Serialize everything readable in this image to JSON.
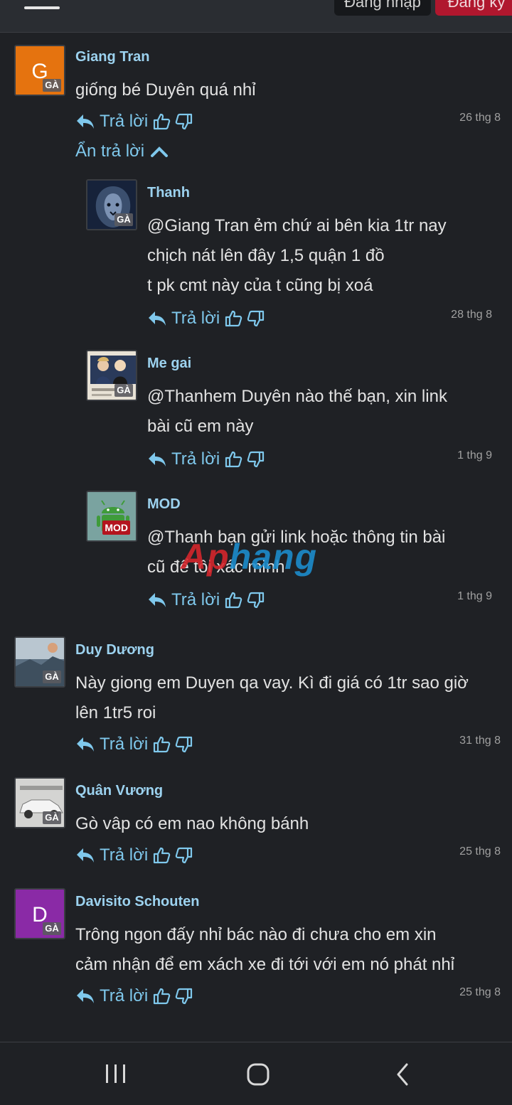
{
  "header": {
    "login_label": "Đăng nhập",
    "register_label": "Đăng ký"
  },
  "labels": {
    "reply": "Trả lời",
    "hide_replies": "Ẩn trả lời"
  },
  "comments": [
    {
      "author": "Giang Tran",
      "avatar_letter": "G",
      "avatar_color": "#e5730f",
      "badge": "GÀ",
      "lines": [
        "giống bé Duyên quá nhỉ"
      ],
      "time": "26 thg 8"
    },
    {
      "author": "Duy Dương",
      "badge": "GÀ",
      "lines": [
        "Này giong em Duyen qa vay. Kì đi giá có 1tr sao giờ",
        "lên 1tr5 roi"
      ],
      "time": "31 thg 8"
    },
    {
      "author": "Quân Vương",
      "badge": "GÀ",
      "lines": [
        "Gò vâp có em nao không bánh"
      ],
      "time": "25 thg 8"
    },
    {
      "author": "Davisito Schouten",
      "avatar_letter": "D",
      "avatar_color": "#8a2aa6",
      "badge": "GÀ",
      "lines": [
        "Trông ngon đấy nhỉ bác nào đi chưa cho em xin",
        "cảm nhận để em xách xe đi tới với em nó phát nhỉ"
      ],
      "time": "25 thg 8"
    }
  ],
  "replies": [
    {
      "author": "Thanh",
      "badge": "GÀ",
      "lines": [
        "@Giang Tran ẻm chứ ai bên kia 1tr nay",
        "chịch nát lên đây 1,5 quận 1 đồ",
        "t pk cmt này của t cũng bị xoá"
      ],
      "time": "28 thg 8"
    },
    {
      "author": "Me gai",
      "badge": "GÀ",
      "lines": [
        "@Thanhem Duyên nào thế bạn, xin link",
        "bài cũ em này"
      ],
      "time": "1 thg 9"
    },
    {
      "author": "MOD",
      "badge": "MOD",
      "lines": [
        "@Thanh bạn gửi link hoặc thông tin bài",
        "cũ để tôi xác minh"
      ],
      "time": "1 thg 9"
    }
  ],
  "watermark": {
    "part1": "Ap",
    "part2": "hang"
  },
  "colors": {
    "accent": "#7fc8ec",
    "name": "#9cd2ef",
    "background": "#1f2125",
    "mod_badge": "#b3141e"
  }
}
